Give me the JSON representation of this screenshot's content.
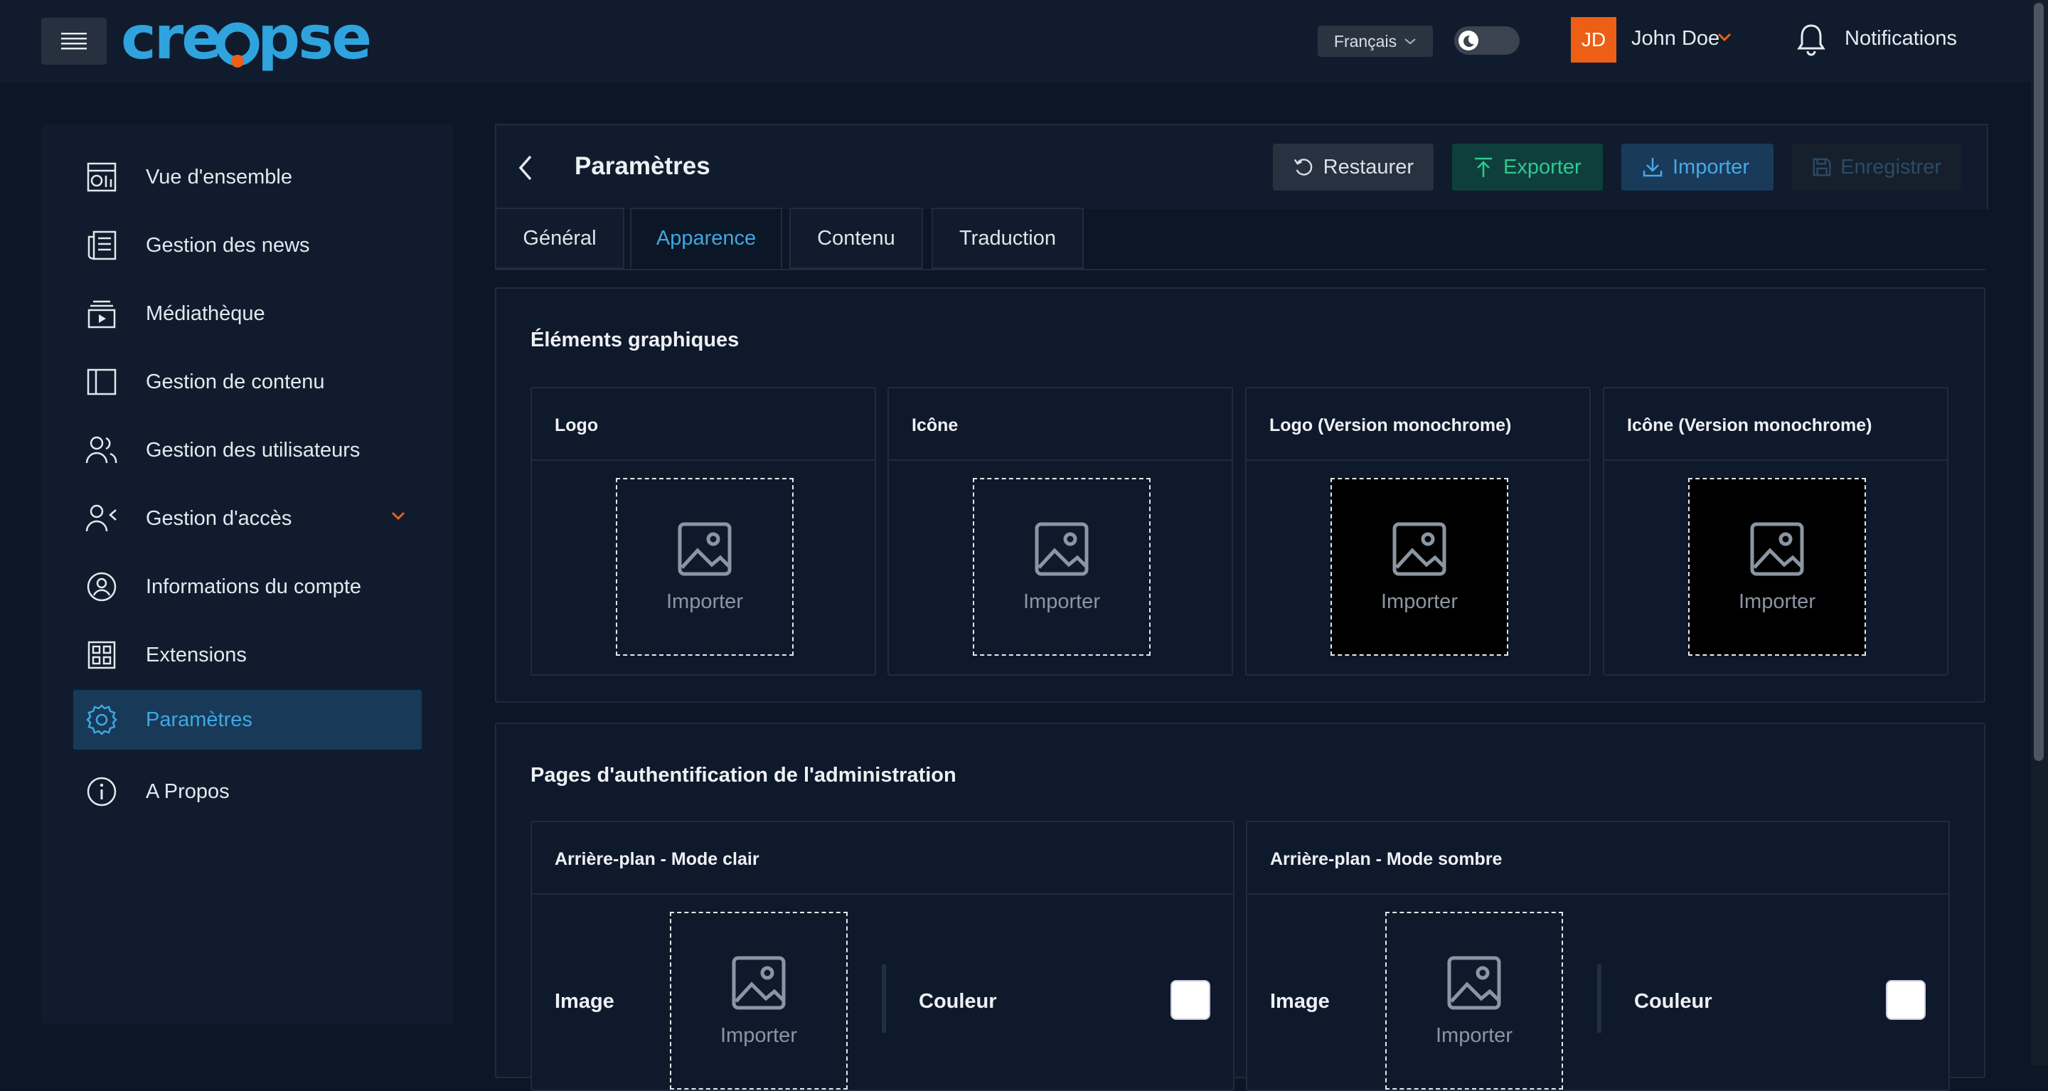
{
  "brand": {
    "logo_text": "creopse"
  },
  "topbar": {
    "language": "Français",
    "user_initials": "JD",
    "user_name": "John Doe",
    "notifications_label": "Notifications"
  },
  "sidebar": {
    "items": [
      {
        "label": "Vue d'ensemble",
        "icon": "dashboard-icon"
      },
      {
        "label": "Gestion des news",
        "icon": "newspaper-icon"
      },
      {
        "label": "Médiathèque",
        "icon": "media-library-icon"
      },
      {
        "label": "Gestion de contenu",
        "icon": "layout-icon"
      },
      {
        "label": "Gestion des utilisateurs",
        "icon": "users-icon"
      },
      {
        "label": "Gestion d'accès",
        "icon": "user-access-icon"
      },
      {
        "label": "Informations du compte",
        "icon": "account-circle-icon"
      },
      {
        "label": "Extensions",
        "icon": "extensions-icon"
      },
      {
        "label": "Paramètres",
        "icon": "gear-icon",
        "active": true
      },
      {
        "label": "A Propos",
        "icon": "info-icon"
      }
    ]
  },
  "header": {
    "title": "Paramètres",
    "restore_label": "Restaurer",
    "export_label": "Exporter",
    "import_label": "Importer",
    "save_label": "Enregistrer"
  },
  "tabs": [
    {
      "label": "Général"
    },
    {
      "label": "Apparence",
      "active": true
    },
    {
      "label": "Contenu"
    },
    {
      "label": "Traduction"
    }
  ],
  "graphics": {
    "title": "Éléments graphiques",
    "cards": [
      {
        "title": "Logo",
        "import_label": "Importer",
        "dark": false
      },
      {
        "title": "Icône",
        "import_label": "Importer",
        "dark": false
      },
      {
        "title": "Logo (Version monochrome)",
        "import_label": "Importer",
        "dark": true
      },
      {
        "title": "Icône (Version monochrome)",
        "import_label": "Importer",
        "dark": true
      }
    ]
  },
  "auth_pages": {
    "title": "Pages d'authentification de l'administration",
    "cards": [
      {
        "title": "Arrière-plan - Mode clair",
        "image_label": "Image",
        "import_label": "Importer",
        "color_label": "Couleur",
        "color": "#ffffff"
      },
      {
        "title": "Arrière-plan - Mode sombre",
        "image_label": "Image",
        "import_label": "Importer",
        "color_label": "Couleur",
        "color": "#ffffff"
      }
    ]
  },
  "colors": {
    "accent": "#3ea8e3",
    "export": "#2ec98f",
    "avatar": "#ec5f15",
    "background": "#0b1626"
  }
}
